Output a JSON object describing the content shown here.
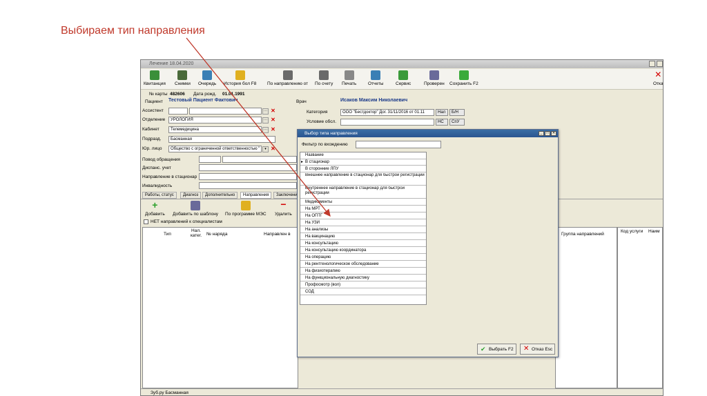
{
  "caption": "Выбираем тип направления",
  "window": {
    "title": "Лечение 18.04.2020",
    "toolbar": [
      {
        "label": "Квитанция",
        "icon": "receipt-icon",
        "color": "#3a8f3a"
      },
      {
        "label": "Снимки",
        "icon": "camera-icon",
        "color": "#4a6a3a"
      },
      {
        "label": "Очередь",
        "icon": "queue-icon",
        "color": "#3a7fb5"
      },
      {
        "label": "История бол F8",
        "icon": "history-book-icon",
        "color": "#e0b020"
      },
      {
        "label": "По направлению от",
        "icon": "referral-icon",
        "color": "#6a6a6a"
      },
      {
        "label": "По счету",
        "icon": "invoice-icon",
        "color": "#6a6a6a"
      },
      {
        "label": "Печать",
        "icon": "printer-icon",
        "color": "#888888"
      },
      {
        "label": "Отчеты",
        "icon": "reports-icon",
        "color": "#3a7fb5"
      },
      {
        "label": "Сервис",
        "icon": "service-icon",
        "color": "#3a9a3a"
      },
      {
        "label": "Проверен",
        "icon": "checked-doc-icon",
        "color": "#6a6a9a"
      },
      {
        "label": "Сохранить F2",
        "icon": "save-check-icon",
        "color": "#3aaa3a"
      },
      {
        "label": "Отка",
        "icon": "cancel-icon",
        "color": "#d40000"
      }
    ],
    "card_label": "№ карты",
    "card_value": "482606",
    "dob_label": "Дата рожд.",
    "dob_value": "01.01.1991",
    "patient_label": "Пациент",
    "patient_value": "Тестовый Пациент Фактович",
    "doctor_label": "Врач",
    "doctor_value": "Исаков Максим Николаевич",
    "assistant_label": "Ассистент",
    "department_label": "Отделение",
    "department_value": "УРОЛОГИЯ",
    "cabinet_label": "Кабинет",
    "cabinet_value": "Телемедицина",
    "subdivision_label": "Подразд.",
    "subdivision_value": "Басманная",
    "legal_label": "Юр. лицо",
    "legal_value": "Общество с ограниченной ответственностью \"",
    "category_label": "Категория",
    "category_value": "ООО \"Бестдоктор\" Дог. 31/11/2016 от 01.11",
    "cash_value": "Нал",
    "bn_value": "Б/Н",
    "service_cond_label": "Условие обсл.",
    "ns_value": "НС",
    "spu_value": "СпУ",
    "reason_label": "Повод обращения",
    "dispensary_label": "Диспанс. учет",
    "hospital_ref_label": "Направление в стационар",
    "disability_label": "Инвалидность",
    "tabs": [
      "Работы, статус",
      "Диагноз",
      "Дополнительно",
      "Направления",
      "Заключени"
    ],
    "ref_toolbar": [
      "Добавить",
      "Добавить по шаблону",
      "По программе МЭС",
      "Удалить"
    ],
    "no_ref_label": "НЕТ направлений к специалистам",
    "columns": [
      "Тип",
      "Нал. катег.",
      "№ наряда",
      "Направлен в"
    ],
    "right_columns": [
      "Группа направлений",
      "Код услуги",
      "Наим"
    ],
    "status": "Зуб.ру Басманная"
  },
  "dialog": {
    "title": "Выбор типа направления",
    "filter_label": "Фильтр по вхождению",
    "filter_value": "",
    "column_header": "Название",
    "items": [
      "В стационар",
      "В сторонние ЛПУ",
      "Внешнее направление в стационар для быстрой регистрации",
      "Внутреннее направление в стационар для быстрой регистрации",
      "Медикаменты",
      "На МРТ",
      "На ОПТГ",
      "На УЗИ",
      "На анализы",
      "На вакцинацию",
      "На консультацию",
      "На консультацию координатора",
      "На операцию",
      "На рентгенологическое обследование",
      "На физиотерапию",
      "На функциональную диагностику",
      "Профосмотр (вол)",
      "СОД"
    ],
    "select_button": "Выбрать F2",
    "cancel_button": "Отказ Esc"
  }
}
